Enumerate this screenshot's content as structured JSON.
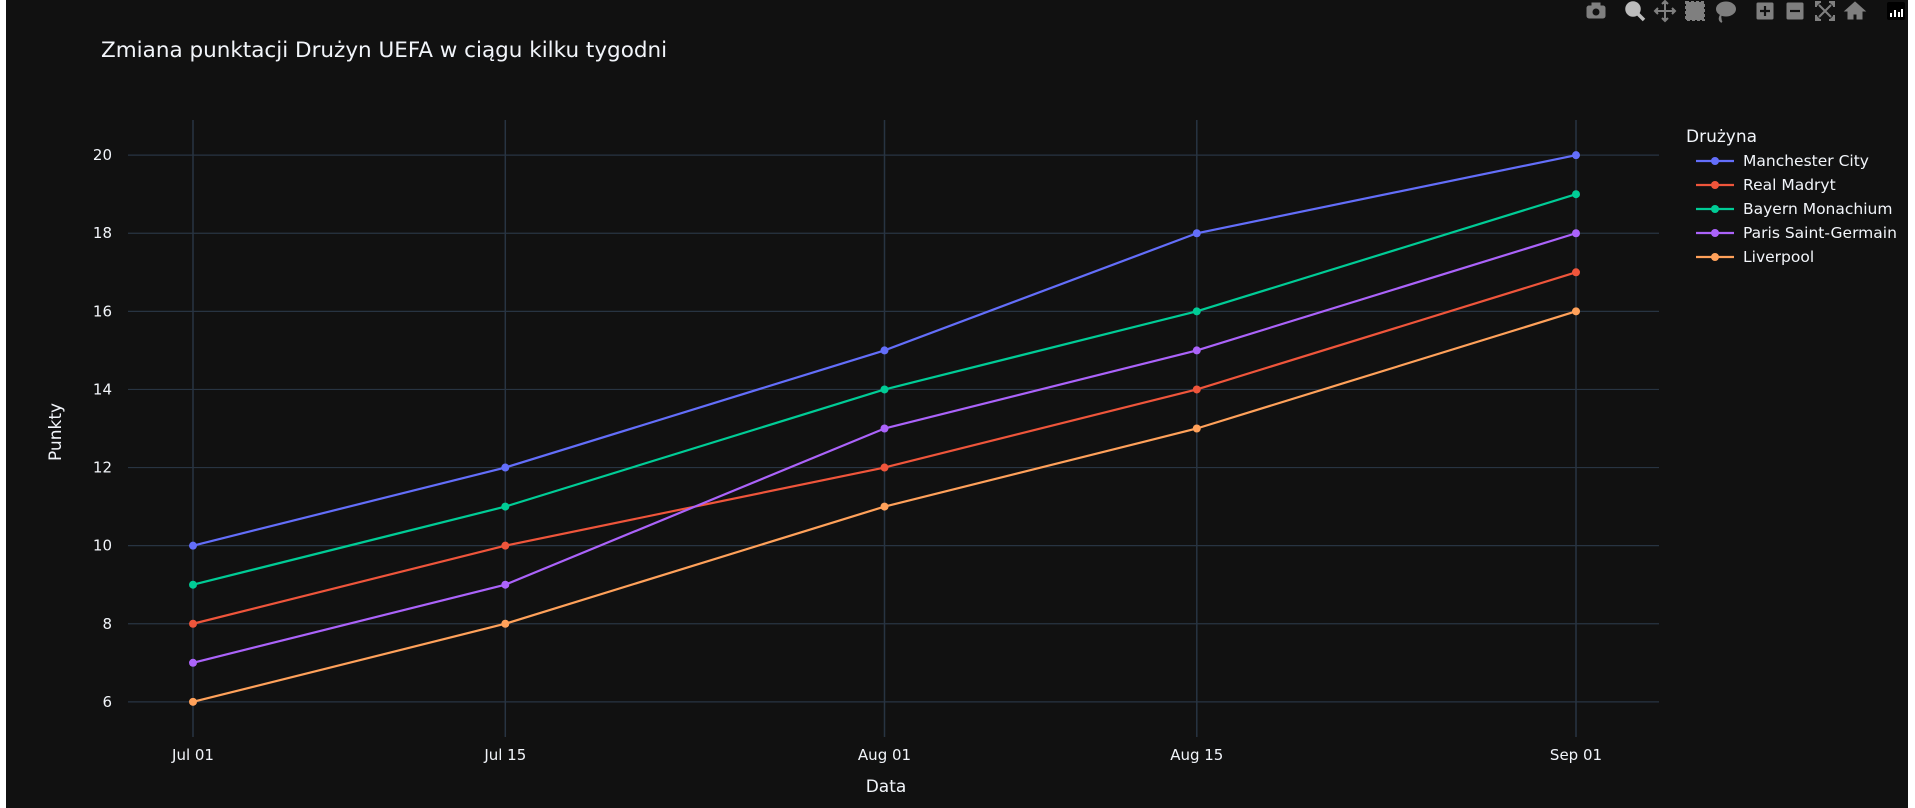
{
  "modebar": {
    "buttons": [
      {
        "icon": "camera-icon",
        "label": "Download plot as a png"
      },
      {
        "icon": "zoom-icon",
        "label": "Zoom"
      },
      {
        "icon": "pan-icon",
        "label": "Pan"
      },
      {
        "icon": "box-select-icon",
        "label": "Box Select"
      },
      {
        "icon": "lasso-select-icon",
        "label": "Lasso Select"
      },
      {
        "icon": "zoom-in-icon",
        "label": "Zoom in"
      },
      {
        "icon": "zoom-out-icon",
        "label": "Zoom out"
      },
      {
        "icon": "autoscale-icon",
        "label": "Autoscale"
      },
      {
        "icon": "reset-axes-icon",
        "label": "Reset axes"
      },
      {
        "icon": "plotly-logo-icon",
        "label": "Produced with Plotly"
      }
    ]
  },
  "chart_data": {
    "type": "line",
    "title": "Zmiana punktacji Drużyn UEFA w ciągu kilku tygodni",
    "xlabel": "Data",
    "ylabel": "Punkty",
    "x": [
      "2023-07-01",
      "2023-07-15",
      "2023-08-01",
      "2023-08-15",
      "2023-09-01"
    ],
    "x_tick_labels": [
      "Jul 01",
      "Jul 15",
      "Aug 01",
      "Aug 15",
      "Sep 01"
    ],
    "y_ticks": [
      6,
      8,
      10,
      12,
      14,
      16,
      18,
      20
    ],
    "ylim": [
      5.1,
      20.9
    ],
    "grid": true,
    "legend": {
      "title": "Drużyna",
      "position": "top-right, outside plot"
    },
    "series": [
      {
        "name": "Manchester City",
        "color": "#636efa",
        "values": [
          10,
          12,
          15,
          18,
          20
        ]
      },
      {
        "name": "Real Madryt",
        "color": "#EF553B",
        "values": [
          8,
          10,
          12,
          14,
          17
        ]
      },
      {
        "name": "Bayern Monachium",
        "color": "#00cc96",
        "values": [
          9,
          11,
          14,
          16,
          19
        ]
      },
      {
        "name": "Paris Saint-Germain",
        "color": "#ab63fa",
        "values": [
          7,
          9,
          13,
          15,
          18
        ]
      },
      {
        "name": "Liverpool",
        "color": "#FFA15A",
        "values": [
          6,
          8,
          11,
          13,
          16
        ]
      }
    ]
  }
}
